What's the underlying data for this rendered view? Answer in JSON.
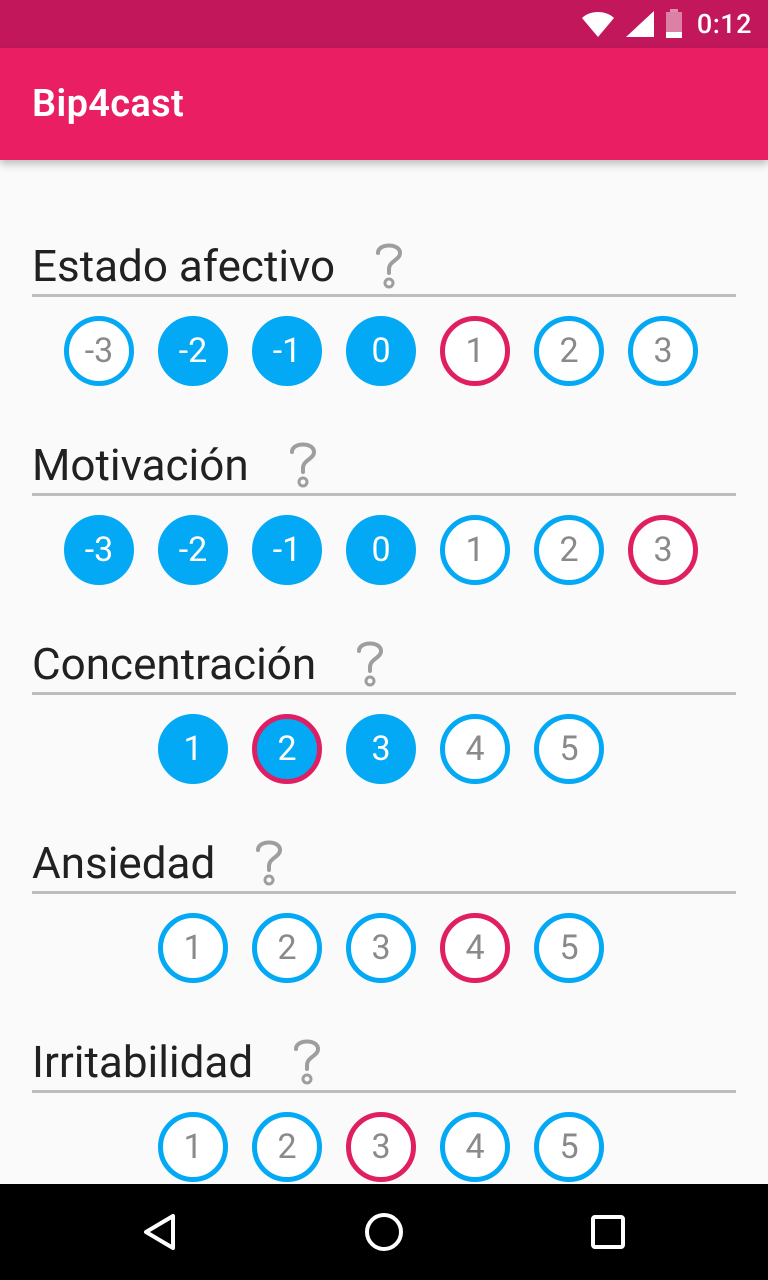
{
  "status_bar": {
    "time": "0:12",
    "icons": [
      "wifi-icon",
      "cell-signal-icon",
      "battery-icon"
    ]
  },
  "app_bar": {
    "title": "Bip4cast"
  },
  "colors": {
    "status_bar": "#c2185b",
    "app_bar": "#e91e63",
    "accent_blue": "#03a9f4",
    "selected_pink": "#e01f62"
  },
  "sections": [
    {
      "title": "Estado afectivo",
      "help_icon": "question-mark-icon",
      "options": [
        {
          "label": "-3",
          "filled": false,
          "selected": false
        },
        {
          "label": "-2",
          "filled": true,
          "selected": false
        },
        {
          "label": "-1",
          "filled": true,
          "selected": false
        },
        {
          "label": "0",
          "filled": true,
          "selected": false
        },
        {
          "label": "1",
          "filled": false,
          "selected": true
        },
        {
          "label": "2",
          "filled": false,
          "selected": false
        },
        {
          "label": "3",
          "filled": false,
          "selected": false
        }
      ]
    },
    {
      "title": "Motivación",
      "help_icon": "question-mark-icon",
      "options": [
        {
          "label": "-3",
          "filled": true,
          "selected": false
        },
        {
          "label": "-2",
          "filled": true,
          "selected": false
        },
        {
          "label": "-1",
          "filled": true,
          "selected": false
        },
        {
          "label": "0",
          "filled": true,
          "selected": false
        },
        {
          "label": "1",
          "filled": false,
          "selected": false
        },
        {
          "label": "2",
          "filled": false,
          "selected": false
        },
        {
          "label": "3",
          "filled": false,
          "selected": true
        }
      ]
    },
    {
      "title": "Concentración",
      "help_icon": "question-mark-icon",
      "options": [
        {
          "label": "1",
          "filled": true,
          "selected": false
        },
        {
          "label": "2",
          "filled": true,
          "selected": true
        },
        {
          "label": "3",
          "filled": true,
          "selected": false
        },
        {
          "label": "4",
          "filled": false,
          "selected": false
        },
        {
          "label": "5",
          "filled": false,
          "selected": false
        }
      ]
    },
    {
      "title": "Ansiedad",
      "help_icon": "question-mark-icon",
      "options": [
        {
          "label": "1",
          "filled": false,
          "selected": false
        },
        {
          "label": "2",
          "filled": false,
          "selected": false
        },
        {
          "label": "3",
          "filled": false,
          "selected": false
        },
        {
          "label": "4",
          "filled": false,
          "selected": true
        },
        {
          "label": "5",
          "filled": false,
          "selected": false
        }
      ]
    },
    {
      "title": "Irritabilidad",
      "help_icon": "question-mark-icon",
      "options": [
        {
          "label": "1",
          "filled": false,
          "selected": false
        },
        {
          "label": "2",
          "filled": false,
          "selected": false
        },
        {
          "label": "3",
          "filled": false,
          "selected": true
        },
        {
          "label": "4",
          "filled": false,
          "selected": false
        },
        {
          "label": "5",
          "filled": false,
          "selected": false
        }
      ]
    }
  ],
  "nav_bar": {
    "buttons": [
      "back-icon",
      "home-icon",
      "recents-icon"
    ]
  }
}
